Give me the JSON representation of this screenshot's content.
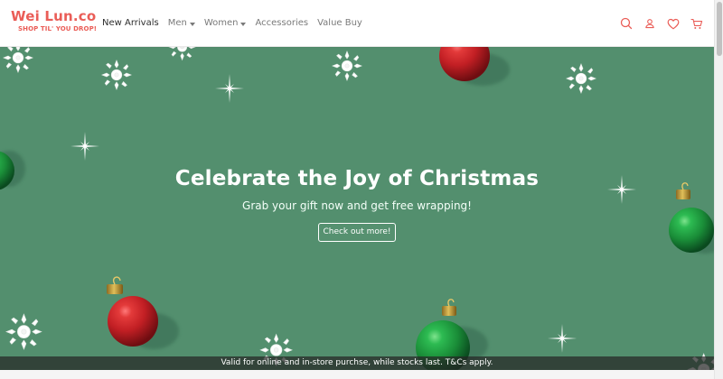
{
  "brand": {
    "name": "Wei Lun.co",
    "tagline": "SHOP TIL' YOU DROP!",
    "color": "#ea5d57"
  },
  "nav": {
    "items": [
      {
        "label": "New Arrivals",
        "has_dropdown": false
      },
      {
        "label": "Men",
        "has_dropdown": true
      },
      {
        "label": "Women",
        "has_dropdown": true
      },
      {
        "label": "Accessories",
        "has_dropdown": false
      },
      {
        "label": "Value Buy",
        "has_dropdown": false
      }
    ],
    "icons": [
      "search-icon",
      "user-icon",
      "heart-icon",
      "cart-icon"
    ],
    "icon_color": "#ea5d57"
  },
  "hero": {
    "title": "Celebrate the Joy of Christmas",
    "subtitle": "Grab your gift now and get free wrapping!",
    "cta_label": "Check out more!",
    "background": "#538f6e"
  },
  "footer": {
    "notice": "Valid for online and in-store purchse, while stocks last. T&Cs apply."
  },
  "decorations": {
    "ornament_colors": [
      "#c92424",
      "#1e8d3c"
    ],
    "snowflake_color": "#ffffff"
  }
}
